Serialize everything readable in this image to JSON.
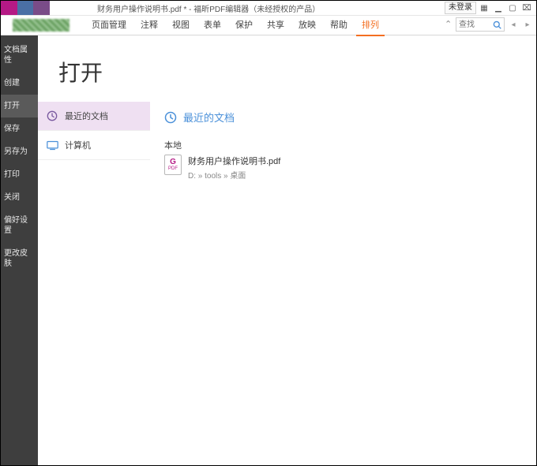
{
  "window": {
    "title": "财务用户操作说明书.pdf * - 福昕PDF编辑器（未经授权的产品）",
    "login_label": "未登录"
  },
  "menubar": {
    "items": [
      "页面管理",
      "注释",
      "视图",
      "表单",
      "保护",
      "共享",
      "放映",
      "帮助"
    ],
    "active_tab": "排列"
  },
  "search": {
    "placeholder": "查找"
  },
  "sidebar": {
    "items": [
      {
        "id": "doc-props",
        "label": "文档属性"
      },
      {
        "id": "create",
        "label": "创建"
      },
      {
        "id": "open",
        "label": "打开"
      },
      {
        "id": "save",
        "label": "保存"
      },
      {
        "id": "save-as",
        "label": "另存为"
      },
      {
        "id": "print",
        "label": "打印"
      },
      {
        "id": "close",
        "label": "关闭"
      },
      {
        "id": "preferences",
        "label": "偏好设置"
      },
      {
        "id": "skin",
        "label": "更改皮肤"
      }
    ],
    "active_id": "open"
  },
  "page": {
    "title": "打开",
    "sources": [
      {
        "id": "recent",
        "label": "最近的文档",
        "selected": true
      },
      {
        "id": "computer",
        "label": "计算机",
        "selected": false
      }
    ],
    "detail_header": "最近的文档",
    "section_label": "本地",
    "files": [
      {
        "name": "财务用户操作说明书.pdf",
        "path": "D: » tools » 桌面"
      }
    ]
  }
}
